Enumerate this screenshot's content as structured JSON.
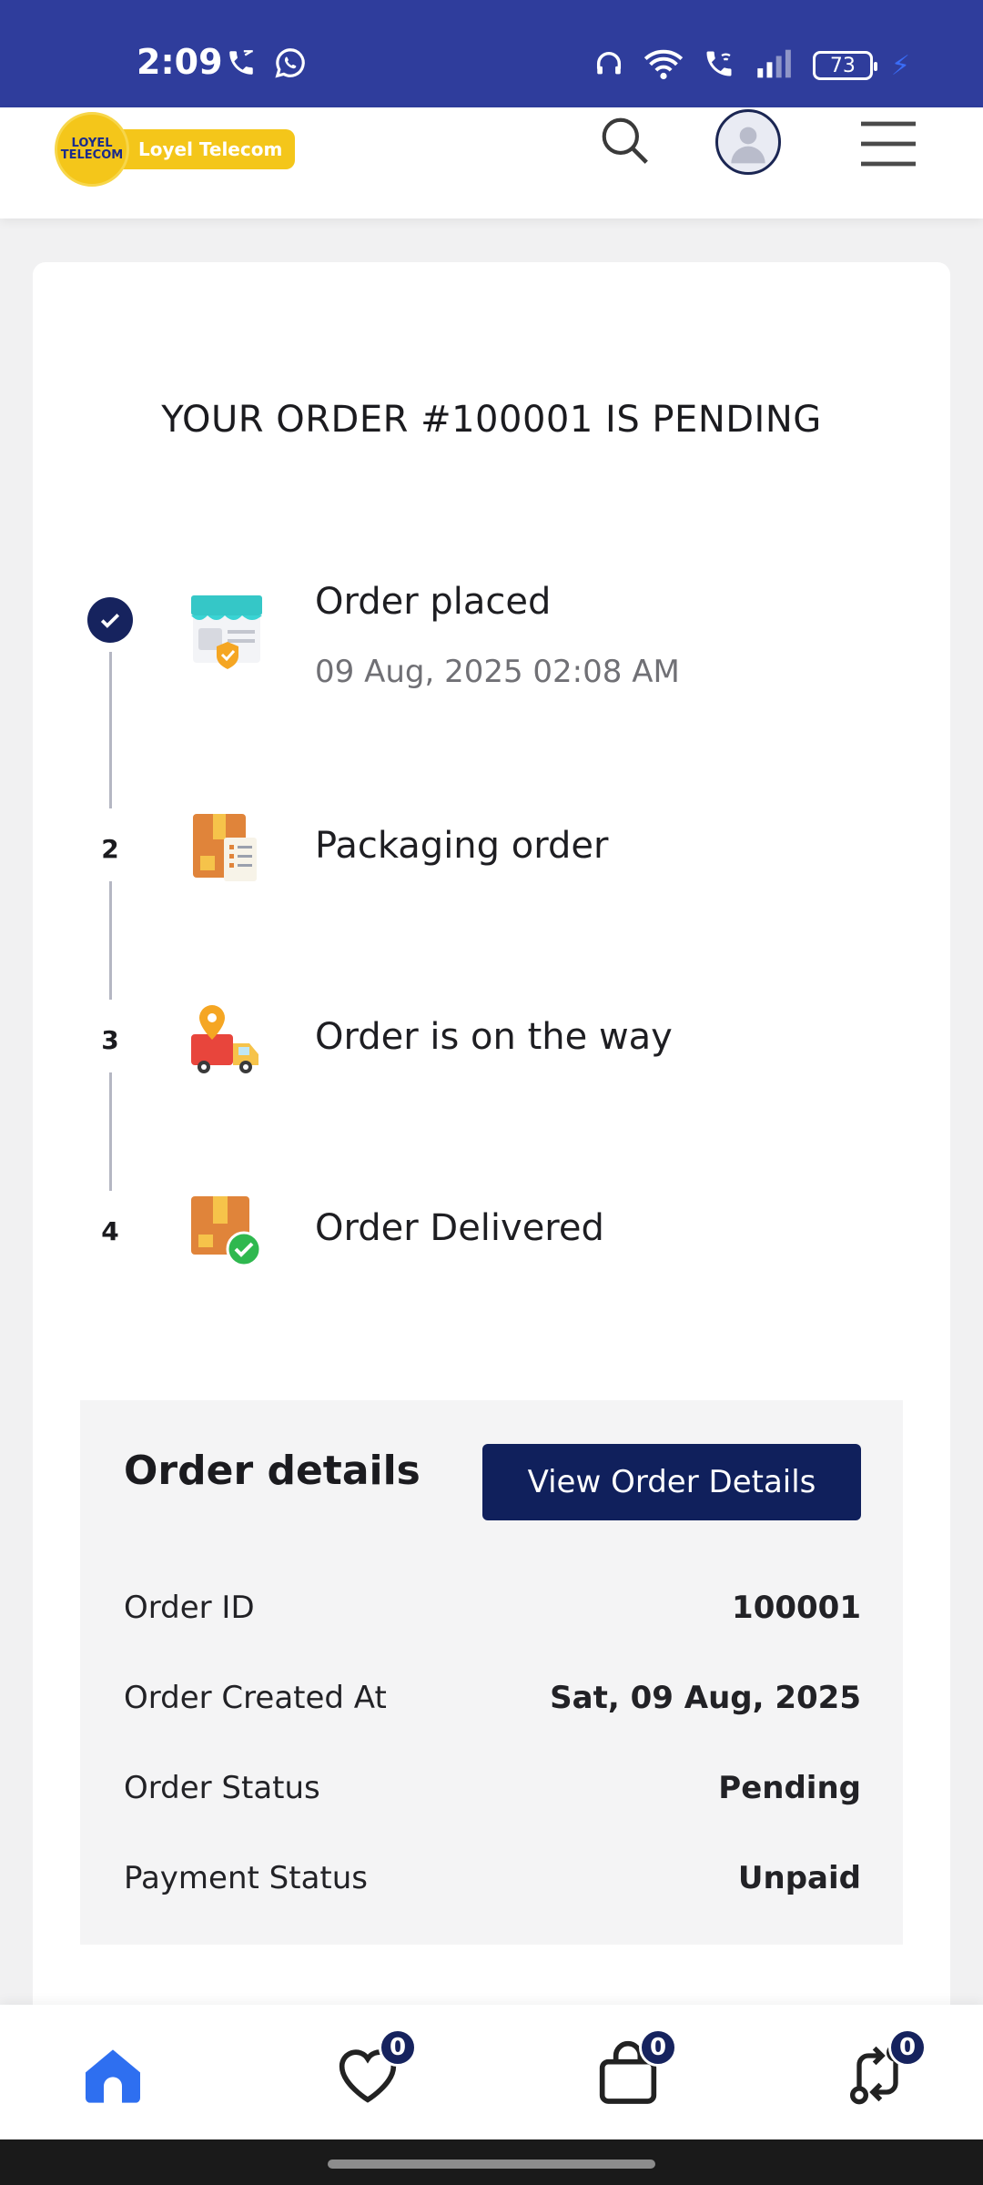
{
  "status_bar": {
    "time": "2:09",
    "battery": "73",
    "icons": [
      "phone-call-icon",
      "whatsapp-icon",
      "headphones-icon",
      "wifi-icon",
      "wifi-calling-icon",
      "signal-icon",
      "battery-icon",
      "charging-icon"
    ]
  },
  "header": {
    "logo_badge": "LOYEL TELECOM",
    "logo_text": "Loyel Telecom",
    "icons": [
      "search-icon",
      "avatar-icon",
      "hamburger-menu-icon"
    ]
  },
  "order": {
    "title": "YOUR ORDER #100001 IS PENDING",
    "steps": [
      {
        "marker": "",
        "label": "Order placed",
        "date": "09 Aug, 2025 02:08 AM",
        "done": true,
        "icon": "store-shield-icon"
      },
      {
        "marker": "2",
        "label": "Packaging order",
        "icon": "package-checklist-icon"
      },
      {
        "marker": "3",
        "label": "Order is on the way",
        "icon": "delivery-truck-icon"
      },
      {
        "marker": "4",
        "label": "Order Delivered",
        "icon": "package-delivered-icon"
      }
    ]
  },
  "details": {
    "title": "Order details",
    "button": "View Order Details",
    "rows": [
      {
        "key": "Order ID",
        "value": "100001"
      },
      {
        "key": "Order Created At",
        "value": "Sat, 09 Aug, 2025"
      },
      {
        "key": "Order Status",
        "value": "Pending"
      },
      {
        "key": "Payment Status",
        "value": "Unpaid"
      }
    ]
  },
  "bottom_nav": {
    "items": [
      {
        "icon": "home-icon",
        "badge": ""
      },
      {
        "icon": "wishlist-heart-icon",
        "badge": "0"
      },
      {
        "icon": "cart-bag-icon",
        "badge": "0"
      },
      {
        "icon": "compare-icon",
        "badge": "0"
      }
    ]
  },
  "colors": {
    "status_bar": "#2f3d9c",
    "primary": "#10205c",
    "home_active": "#2e6ff0",
    "logo_yellow": "#f4c61a"
  }
}
